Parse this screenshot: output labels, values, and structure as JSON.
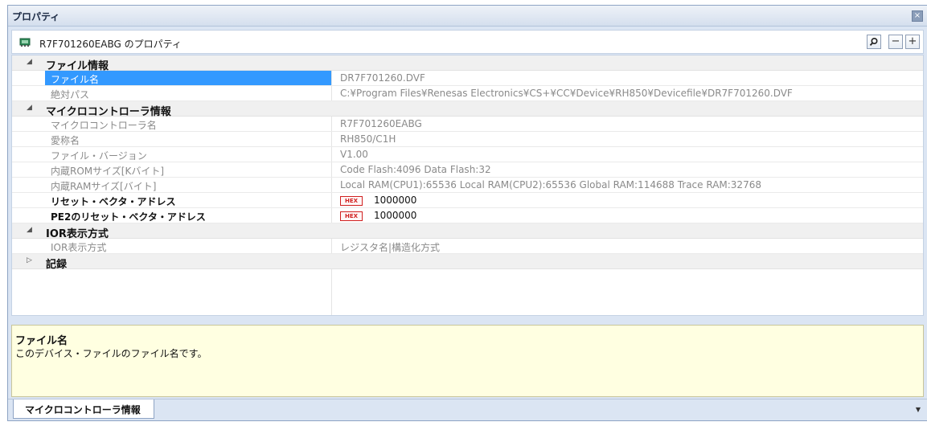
{
  "panel": {
    "title": "プロパティ",
    "close_glyph": "×"
  },
  "object_bar": {
    "label": "R7F701260EABG のプロパティ",
    "search_glyph": "⌕",
    "collapse_glyph": "−",
    "expand_glyph": "+"
  },
  "categories": [
    {
      "label": "ファイル情報",
      "toggle": "◢",
      "rows": [
        {
          "name": "ファイル名",
          "value": "DR7F701260.DVF"
        },
        {
          "name": "絶対パス",
          "value": "C:¥Program Files¥Renesas Electronics¥CS+¥CC¥Device¥RH850¥Devicefile¥DR7F701260.DVF"
        }
      ]
    },
    {
      "label": "マイクロコントローラ情報",
      "toggle": "◢",
      "rows": [
        {
          "name": "マイクロコントローラ名",
          "value": "R7F701260EABG"
        },
        {
          "name": "愛称名",
          "value": "RH850/C1H"
        },
        {
          "name": "ファイル・バージョン",
          "value": "V1.00"
        },
        {
          "name": "内蔵ROMサイズ[Kバイト]",
          "value": "Code Flash:4096 Data Flash:32"
        },
        {
          "name": "内蔵RAMサイズ[バイト]",
          "value": "Local RAM(CPU1):65536 Local RAM(CPU2):65536 Global RAM:114688 Trace RAM:32768"
        },
        {
          "name": "リセット・ベクタ・アドレス",
          "value": "1000000",
          "hex_badge": "HEX"
        },
        {
          "name": "PE2のリセット・ベクタ・アドレス",
          "value": "1000000",
          "hex_badge": "HEX"
        }
      ]
    },
    {
      "label": "IOR表示方式",
      "toggle": "◢",
      "rows": [
        {
          "name": "IOR表示方式",
          "value": "レジスタ名|構造化方式"
        }
      ]
    },
    {
      "label": "記録",
      "toggle": "▷",
      "rows": []
    }
  ],
  "description": {
    "title": "ファイル名",
    "text": "このデバイス・ファイルのファイル名です。"
  },
  "tabs": {
    "active": "マイクロコントローラ情報",
    "menu_glyph": "▼"
  },
  "colors": {
    "selection": "#3399ff",
    "hex_badge": "#d02020",
    "description_bg": "#ffffe1"
  }
}
